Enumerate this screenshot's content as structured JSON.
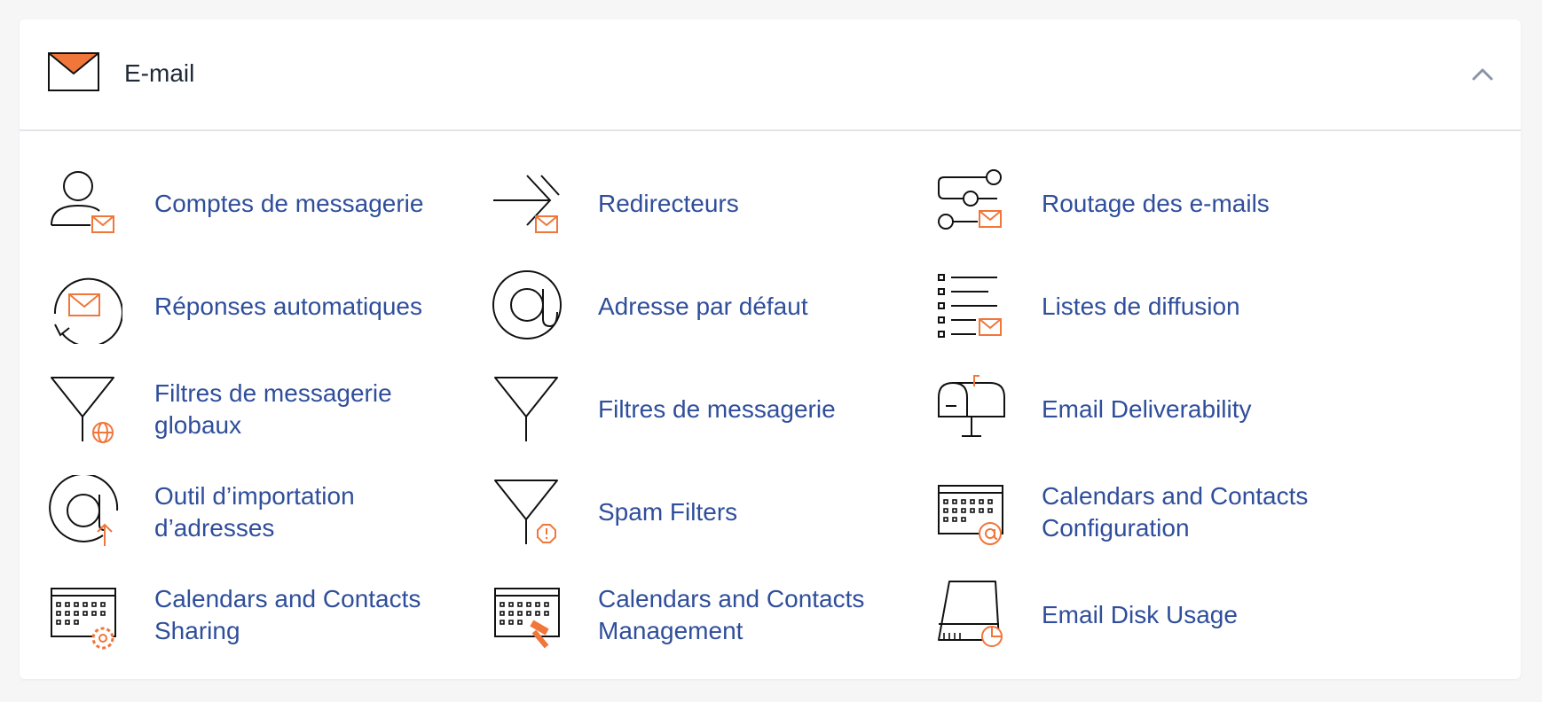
{
  "section": {
    "title": "E-mail",
    "accent_color": "#f0763a",
    "link_color": "#2f4e9b",
    "items": [
      {
        "label": "Comptes de messagerie",
        "icon": "user-mail-icon"
      },
      {
        "label": "Redirecteurs",
        "icon": "forwarder-icon"
      },
      {
        "label": "Routage des e-mails",
        "icon": "routing-icon"
      },
      {
        "label": "Réponses automatiques",
        "icon": "autoresponder-icon"
      },
      {
        "label": "Adresse par défaut",
        "icon": "at-sign-icon"
      },
      {
        "label": "Listes de diffusion",
        "icon": "mailing-list-icon"
      },
      {
        "label": "Filtres de messagerie globaux",
        "icon": "global-filter-icon"
      },
      {
        "label": "Filtres de messagerie",
        "icon": "filter-icon"
      },
      {
        "label": "Email Deliverability",
        "icon": "mailbox-icon"
      },
      {
        "label": "Outil d’importation d’adresses",
        "icon": "address-import-icon"
      },
      {
        "label": "Spam Filters",
        "icon": "spam-filter-icon"
      },
      {
        "label": "Calendars and Contacts Configuration",
        "icon": "calendar-at-icon"
      },
      {
        "label": "Calendars and Contacts Sharing",
        "icon": "calendar-gear-icon"
      },
      {
        "label": "Calendars and Contacts Management",
        "icon": "calendar-hammer-icon"
      },
      {
        "label": "Email Disk Usage",
        "icon": "disk-usage-icon"
      }
    ]
  }
}
